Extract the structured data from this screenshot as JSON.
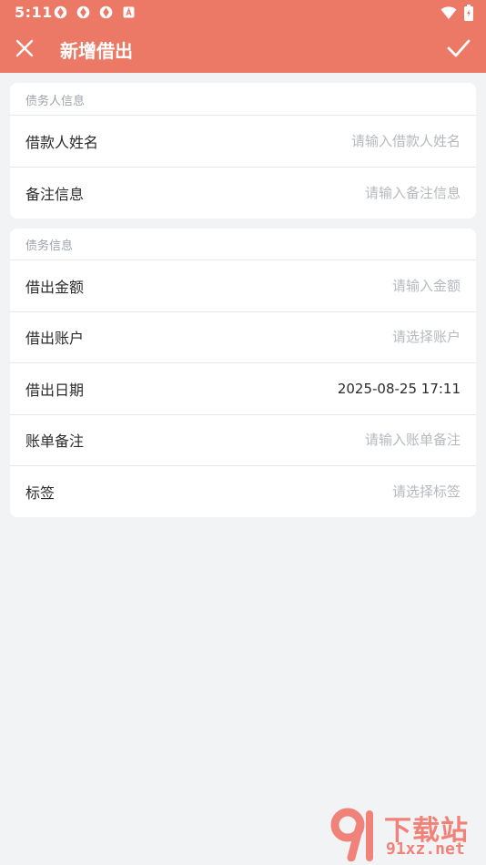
{
  "status_bar": {
    "time": "5:11",
    "icons_left": [
      "notification-app-icon",
      "notification-app-icon",
      "notification-app-icon",
      "notification-a-icon"
    ],
    "icons_right": [
      "wifi-icon",
      "battery-icon"
    ]
  },
  "toolbar": {
    "title": "新增借出",
    "background": "#ec7866"
  },
  "debtor_section": {
    "header": "债务人信息",
    "rows": [
      {
        "label": "借款人姓名",
        "placeholder": "请输入借款人姓名",
        "value": ""
      },
      {
        "label": "备注信息",
        "placeholder": "请输入备注信息",
        "value": ""
      }
    ]
  },
  "debt_section": {
    "header": "债务信息",
    "rows": [
      {
        "label": "借出金额",
        "placeholder": "请输入金额",
        "value": ""
      },
      {
        "label": "借出账户",
        "placeholder": "请选择账户",
        "value": ""
      },
      {
        "label": "借出日期",
        "value": "2025-08-25 17:11"
      },
      {
        "label": "账单备注",
        "placeholder": "请输入账单备注",
        "value": ""
      },
      {
        "label": "标签",
        "placeholder": "请选择标签",
        "value": ""
      }
    ]
  },
  "watermark": {
    "top": "下载站",
    "bottom": "91xz.net"
  }
}
